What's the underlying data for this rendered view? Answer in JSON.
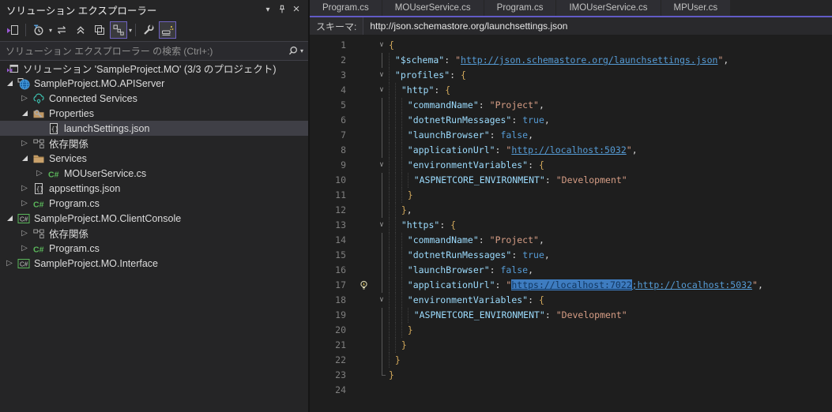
{
  "colors": {
    "accent_purple": "#625BC6",
    "selection_blue": "#3E7CC0",
    "editor_background": "#1E1E1E",
    "panel_background": "#252526",
    "tree_selection_background": "#3F3F46",
    "json_key": "#9CDCFE",
    "json_string": "#D69D85",
    "json_link": "#569CD6",
    "json_keyword": "#569CD6",
    "json_brace": "#D0A75A"
  },
  "solution_explorer": {
    "title": "ソリューション エクスプローラー",
    "title_buttons": [
      {
        "name": "window-position-dropdown",
        "icon": "chevron-down-icon"
      },
      {
        "name": "pin",
        "icon": "pin-icon"
      },
      {
        "name": "close",
        "icon": "close-icon"
      }
    ],
    "toolbar_buttons": [
      {
        "name": "switch-views",
        "icon": "switch-views-icon"
      },
      {
        "name": "open-files-filter",
        "icon": "clock-filter-icon",
        "dropdown": true
      },
      {
        "name": "sync-with-active-document",
        "icon": "sync-arrows-icon"
      },
      {
        "name": "collapse-all",
        "icon": "collapse-all-icon"
      },
      {
        "name": "properties-window",
        "icon": "overlapping-windows-icon"
      },
      {
        "name": "preview-selected-items",
        "icon": "linked-items-icon",
        "active": true,
        "dropdown": true
      },
      {
        "name": "edit-project-file",
        "icon": "wrench-icon"
      },
      {
        "name": "show-all-files",
        "icon": "show-all-files-icon",
        "active": true
      }
    ],
    "search": {
      "placeholder": "ソリューション エクスプローラー の検索 (Ctrl+:)"
    },
    "tree": [
      {
        "label": "ソリューション 'SampleProject.MO' (3/3 のプロジェクト)",
        "level": 0,
        "expander": "none",
        "icon": "solution",
        "selected": false
      },
      {
        "label": "SampleProject.MO.APIServer",
        "level": 1,
        "expander": "expanded",
        "icon": "web-project",
        "selected": false
      },
      {
        "label": "Connected Services",
        "level": 2,
        "expander": "collapsed",
        "icon": "cloud",
        "selected": false
      },
      {
        "label": "Properties",
        "level": 2,
        "expander": "expanded",
        "icon": "properties-folder",
        "selected": false
      },
      {
        "label": "launchSettings.json",
        "level": 3,
        "expander": "none",
        "icon": "json-file",
        "selected": true
      },
      {
        "label": "依存関係",
        "level": 2,
        "expander": "collapsed",
        "icon": "dependencies",
        "selected": false
      },
      {
        "label": "Services",
        "level": 2,
        "expander": "expanded",
        "icon": "folder",
        "selected": false
      },
      {
        "label": "MOUserService.cs",
        "level": 3,
        "expander": "collapsed",
        "icon": "csharp-file",
        "selected": false
      },
      {
        "label": "appsettings.json",
        "level": 2,
        "expander": "collapsed",
        "icon": "json-file",
        "selected": false
      },
      {
        "label": "Program.cs",
        "level": 2,
        "expander": "collapsed",
        "icon": "csharp-file",
        "selected": false
      },
      {
        "label": "SampleProject.MO.ClientConsole",
        "level": 1,
        "expander": "expanded",
        "icon": "csharp-project",
        "selected": false
      },
      {
        "label": "依存関係",
        "level": 2,
        "expander": "collapsed",
        "icon": "dependencies",
        "selected": false
      },
      {
        "label": "Program.cs",
        "level": 2,
        "expander": "collapsed",
        "icon": "csharp-file",
        "selected": false
      },
      {
        "label": "SampleProject.MO.Interface",
        "level": 1,
        "expander": "collapsed",
        "icon": "csharp-project",
        "selected": false
      }
    ]
  },
  "editor": {
    "tabs": [
      {
        "label": "Program.cs"
      },
      {
        "label": "MOUserService.cs"
      },
      {
        "label": "Program.cs"
      },
      {
        "label": "IMOUserService.cs"
      },
      {
        "label": "MPUser.cs"
      }
    ],
    "schema_bar": {
      "label": "スキーマ:",
      "value": "http://json.schemastore.org/launchsettings.json"
    },
    "code": {
      "lines": [
        {
          "num": 1,
          "fold": true,
          "ind": 0,
          "seg": [
            [
              "br",
              "{"
            ]
          ]
        },
        {
          "num": 2,
          "fold": false,
          "ind": 1,
          "seg": [
            [
              "k",
              "\"$schema\""
            ],
            [
              "p",
              ": "
            ],
            [
              "s",
              "\""
            ],
            [
              "l",
              "http://json.schemastore.org/launchsettings.json"
            ],
            [
              "s",
              "\""
            ],
            [
              "p",
              ","
            ]
          ]
        },
        {
          "num": 3,
          "fold": true,
          "ind": 1,
          "seg": [
            [
              "k",
              "\"profiles\""
            ],
            [
              "p",
              ": "
            ],
            [
              "br",
              "{"
            ]
          ]
        },
        {
          "num": 4,
          "fold": true,
          "ind": 2,
          "seg": [
            [
              "k",
              "\"http\""
            ],
            [
              "p",
              ": "
            ],
            [
              "br",
              "{"
            ]
          ]
        },
        {
          "num": 5,
          "fold": false,
          "ind": 3,
          "seg": [
            [
              "k",
              "\"commandName\""
            ],
            [
              "p",
              ": "
            ],
            [
              "s",
              "\"Project\""
            ],
            [
              "p",
              ","
            ]
          ]
        },
        {
          "num": 6,
          "fold": false,
          "ind": 3,
          "seg": [
            [
              "k",
              "\"dotnetRunMessages\""
            ],
            [
              "p",
              ": "
            ],
            [
              "b",
              "true"
            ],
            [
              "p",
              ","
            ]
          ]
        },
        {
          "num": 7,
          "fold": false,
          "ind": 3,
          "seg": [
            [
              "k",
              "\"launchBrowser\""
            ],
            [
              "p",
              ": "
            ],
            [
              "b",
              "false"
            ],
            [
              "p",
              ","
            ]
          ]
        },
        {
          "num": 8,
          "fold": false,
          "ind": 3,
          "seg": [
            [
              "k",
              "\"applicationUrl\""
            ],
            [
              "p",
              ": "
            ],
            [
              "s",
              "\""
            ],
            [
              "l",
              "http://localhost:5032"
            ],
            [
              "s",
              "\""
            ],
            [
              "p",
              ","
            ]
          ]
        },
        {
          "num": 9,
          "fold": true,
          "ind": 3,
          "seg": [
            [
              "k",
              "\"environmentVariables\""
            ],
            [
              "p",
              ": "
            ],
            [
              "br",
              "{"
            ]
          ]
        },
        {
          "num": 10,
          "fold": false,
          "ind": 4,
          "seg": [
            [
              "k",
              "\"ASPNETCORE_ENVIRONMENT\""
            ],
            [
              "p",
              ": "
            ],
            [
              "s",
              "\"Development\""
            ]
          ]
        },
        {
          "num": 11,
          "fold": false,
          "ind": 3,
          "seg": [
            [
              "br",
              "}"
            ]
          ]
        },
        {
          "num": 12,
          "fold": false,
          "ind": 2,
          "seg": [
            [
              "br",
              "}"
            ],
            [
              "p",
              ","
            ]
          ]
        },
        {
          "num": 13,
          "fold": true,
          "ind": 2,
          "seg": [
            [
              "k",
              "\"https\""
            ],
            [
              "p",
              ": "
            ],
            [
              "br",
              "{"
            ]
          ]
        },
        {
          "num": 14,
          "fold": false,
          "ind": 3,
          "seg": [
            [
              "k",
              "\"commandName\""
            ],
            [
              "p",
              ": "
            ],
            [
              "s",
              "\"Project\""
            ],
            [
              "p",
              ","
            ]
          ]
        },
        {
          "num": 15,
          "fold": false,
          "ind": 3,
          "seg": [
            [
              "k",
              "\"dotnetRunMessages\""
            ],
            [
              "p",
              ": "
            ],
            [
              "b",
              "true"
            ],
            [
              "p",
              ","
            ]
          ]
        },
        {
          "num": 16,
          "fold": false,
          "ind": 3,
          "seg": [
            [
              "k",
              "\"launchBrowser\""
            ],
            [
              "p",
              ": "
            ],
            [
              "b",
              "false"
            ],
            [
              "p",
              ","
            ]
          ]
        },
        {
          "num": 17,
          "fold": false,
          "bulb": true,
          "ind": 3,
          "seg": [
            [
              "k",
              "\"applicationUrl\""
            ],
            [
              "p",
              ": "
            ],
            [
              "s",
              "\""
            ],
            [
              "sel",
              "https://localhost:7022"
            ],
            [
              "l",
              ";http://localhost:5032"
            ],
            [
              "s",
              "\""
            ],
            [
              "p",
              ","
            ]
          ]
        },
        {
          "num": 18,
          "fold": true,
          "ind": 3,
          "seg": [
            [
              "k",
              "\"environmentVariables\""
            ],
            [
              "p",
              ": "
            ],
            [
              "br",
              "{"
            ]
          ]
        },
        {
          "num": 19,
          "fold": false,
          "ind": 4,
          "seg": [
            [
              "k",
              "\"ASPNETCORE_ENVIRONMENT\""
            ],
            [
              "p",
              ": "
            ],
            [
              "s",
              "\"Development\""
            ]
          ]
        },
        {
          "num": 20,
          "fold": false,
          "ind": 3,
          "seg": [
            [
              "br",
              "}"
            ]
          ]
        },
        {
          "num": 21,
          "fold": false,
          "ind": 2,
          "seg": [
            [
              "br",
              "}"
            ]
          ]
        },
        {
          "num": 22,
          "fold": false,
          "ind": 1,
          "seg": [
            [
              "br",
              "}"
            ]
          ]
        },
        {
          "num": 23,
          "fold": false,
          "ind": 0,
          "seg": [
            [
              "br",
              "}"
            ]
          ]
        },
        {
          "num": 24,
          "fold": false,
          "ind": 0,
          "seg": []
        }
      ]
    }
  }
}
